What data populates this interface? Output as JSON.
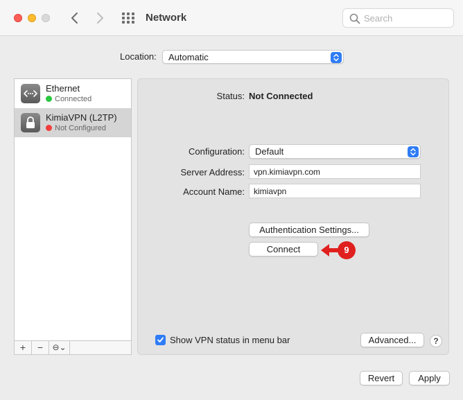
{
  "window": {
    "title": "Network",
    "search_placeholder": "Search"
  },
  "location": {
    "label": "Location:",
    "value": "Automatic"
  },
  "sidebar": {
    "services": [
      {
        "name": "Ethernet",
        "status": "Connected",
        "status_color": "#2ac840",
        "icon": "ethernet-icon"
      },
      {
        "name": "KimiaVPN (L2TP)",
        "status": "Not Configured",
        "status_color": "#f23d3c",
        "icon": "lock-icon",
        "selected": true
      }
    ],
    "toolbar": {
      "add": "+",
      "remove": "−",
      "action": "⊖⌄"
    }
  },
  "detail": {
    "status_label": "Status:",
    "status_value": "Not Connected",
    "configuration_label": "Configuration:",
    "configuration_value": "Default",
    "server_label": "Server Address:",
    "server_value": "vpn.kimiavpn.com",
    "account_label": "Account Name:",
    "account_value": "kimiavpn",
    "auth_button": "Authentication Settings...",
    "connect_button": "Connect",
    "step_badge": "9",
    "show_status_label": "Show VPN status in menu bar",
    "show_status_checked": true,
    "advanced_button": "Advanced...",
    "help_button": "?"
  },
  "footer": {
    "revert_button": "Revert",
    "apply_button": "Apply"
  },
  "colors": {
    "accent": "#2f7cf6",
    "annotation_red": "#e0201e"
  }
}
